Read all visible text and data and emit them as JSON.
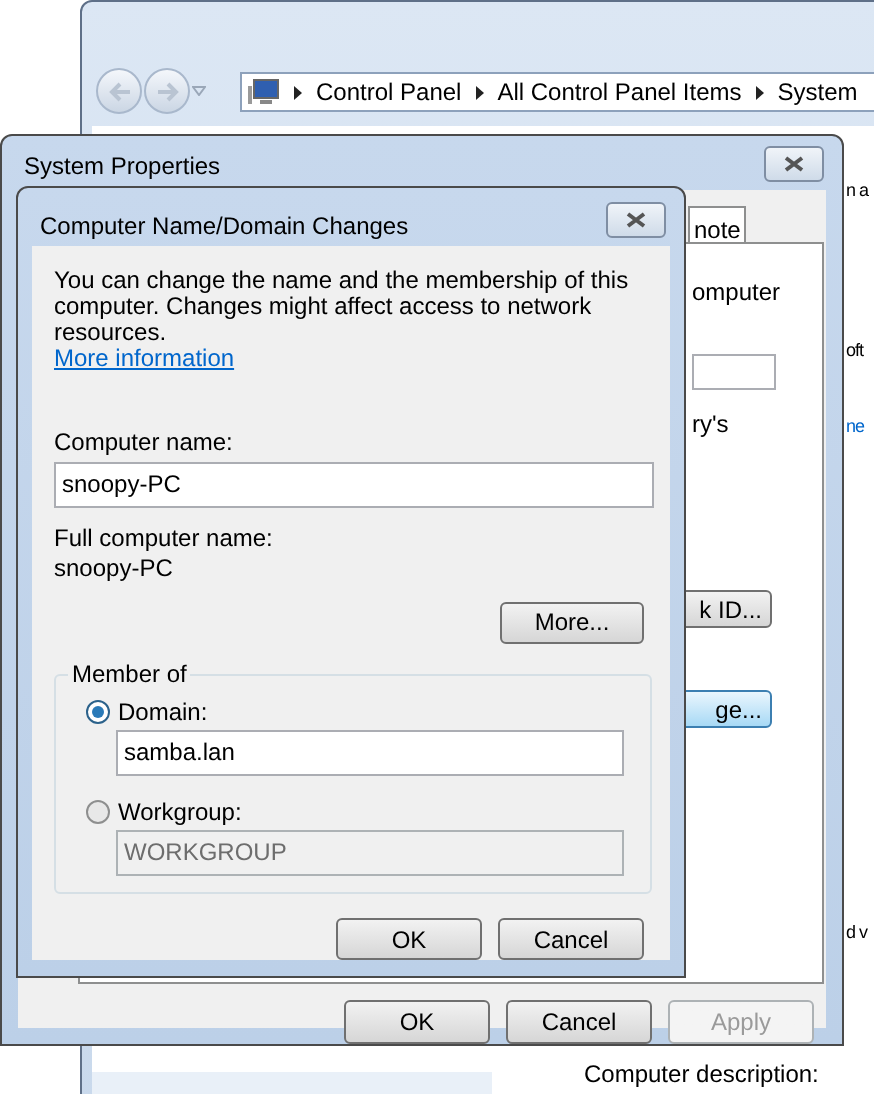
{
  "control_panel_window": {
    "breadcrumbs": [
      "Control Panel",
      "All Control Panel Items",
      "System"
    ],
    "partial_texts": [
      {
        "text": "n a",
        "kind": "text"
      },
      {
        "text": "oft",
        "kind": "text"
      },
      {
        "text": "ne",
        "kind": "link"
      },
      {
        "text": "d v",
        "kind": "text"
      },
      {
        "text": "Computer description:",
        "kind": "text"
      }
    ]
  },
  "system_properties": {
    "title": "System Properties",
    "tab_fragment": "note",
    "partial_texts": [
      "omputer",
      "ry's"
    ],
    "partial_buttons": [
      {
        "label": "k ID...",
        "focused": false
      },
      {
        "label": "ge...",
        "focused": true
      }
    ],
    "buttons": [
      {
        "label": "OK",
        "disabled": false
      },
      {
        "label": "Cancel",
        "disabled": false
      },
      {
        "label": "Apply",
        "disabled": true
      }
    ]
  },
  "dialog": {
    "title": "Computer Name/Domain Changes",
    "intro": "You can change the name and the membership of this computer. Changes might affect access to network resources.",
    "link": "More information",
    "computer_name_label": "Computer name:",
    "computer_name_value": "snoopy-PC",
    "full_name_label": "Full computer name:",
    "full_name_value": "snoopy-PC",
    "more_button": "More...",
    "member_of": {
      "label": "Member of",
      "options": [
        {
          "label": "Domain:",
          "selected": true,
          "value": "samba.lan",
          "disabled": false
        },
        {
          "label": "Workgroup:",
          "selected": false,
          "value": "WORKGROUP",
          "disabled": true
        }
      ]
    },
    "buttons": [
      "OK",
      "Cancel"
    ]
  }
}
